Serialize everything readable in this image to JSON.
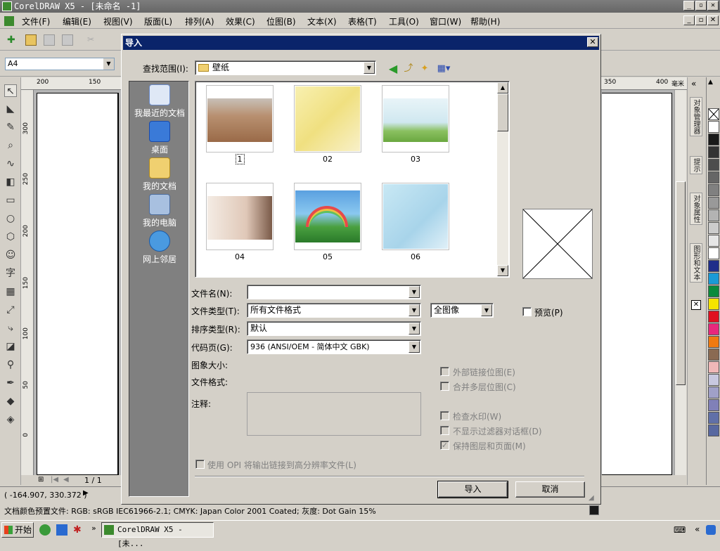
{
  "window": {
    "title": "CorelDRAW X5 - [未命名 -1]"
  },
  "menu": [
    "文件(F)",
    "编辑(E)",
    "视图(V)",
    "版面(L)",
    "排列(A)",
    "效果(C)",
    "位图(B)",
    "文本(X)",
    "表格(T)",
    "工具(O)",
    "窗口(W)",
    "帮助(H)"
  ],
  "propbar": {
    "page_size": "A4"
  },
  "ruler": {
    "h_left": [
      "200",
      "150"
    ],
    "h_right": [
      "350",
      "400",
      "毫米"
    ],
    "v": [
      "300",
      "250",
      "200",
      "150",
      "100",
      "50",
      "0"
    ]
  },
  "pagenav": {
    "counter": "1 / 1"
  },
  "dockers": [
    "对象管理器",
    "提示",
    "对象属性",
    "图形和文本"
  ],
  "palette": [
    "#ffffff",
    "#1a1a1a",
    "#333333",
    "#4d4d4d",
    "#666666",
    "#808080",
    "#999999",
    "#b3b3b3",
    "#cccccc",
    "#e6e6e6",
    "#ffffff",
    "#1f2e8a",
    "#1a9ad6",
    "#0a8a3c",
    "#f5e400",
    "#e01020",
    "#e8287c",
    "#f07a10",
    "#8a6a52",
    "#f0b8b8",
    "#c8c8e0",
    "#a0a0c8",
    "#8080b8",
    "#6070a8",
    "#5868a0"
  ],
  "status": {
    "coords": "( -164.907, 330.372 )",
    "profile": "文档颜色预置文件: RGB: sRGB IEC61966-2.1; CMYK: Japan Color 2001 Coated; 灰度: Dot Gain 15%"
  },
  "taskbar": {
    "start": "开始",
    "item": "CorelDRAW X5 - [未..."
  },
  "dialog": {
    "title": "导入",
    "look_in_label": "查找范围(I):",
    "look_in_value": "壁纸",
    "places": [
      "我最近的文档",
      "桌面",
      "我的文档",
      "我的电脑",
      "网上邻居"
    ],
    "files": [
      "1",
      "02",
      "03",
      "04",
      "05",
      "06"
    ],
    "filename_label": "文件名(N):",
    "filename_value": "",
    "filetype_label": "文件类型(T):",
    "filetype_value": "所有文件格式",
    "image_mode_value": "全图像",
    "sort_label": "排序类型(R):",
    "sort_value": "默认",
    "codepage_label": "代码页(G):",
    "codepage_value": "936   (ANSI/OEM - 简体中文 GBK)",
    "image_size_label": "图象大小:",
    "file_format_label": "文件格式:",
    "notes_label": "注释:",
    "preview_label": "预览(P)",
    "options": [
      "外部链接位图(E)",
      "合并多层位图(C)",
      "检查水印(W)",
      "不显示过滤器对话框(D)",
      "保持图层和页面(M)"
    ],
    "opi_label": "使用 OPI 将输出链接到高分辨率文件(L)",
    "import_button": "导入",
    "cancel_button": "取消"
  }
}
